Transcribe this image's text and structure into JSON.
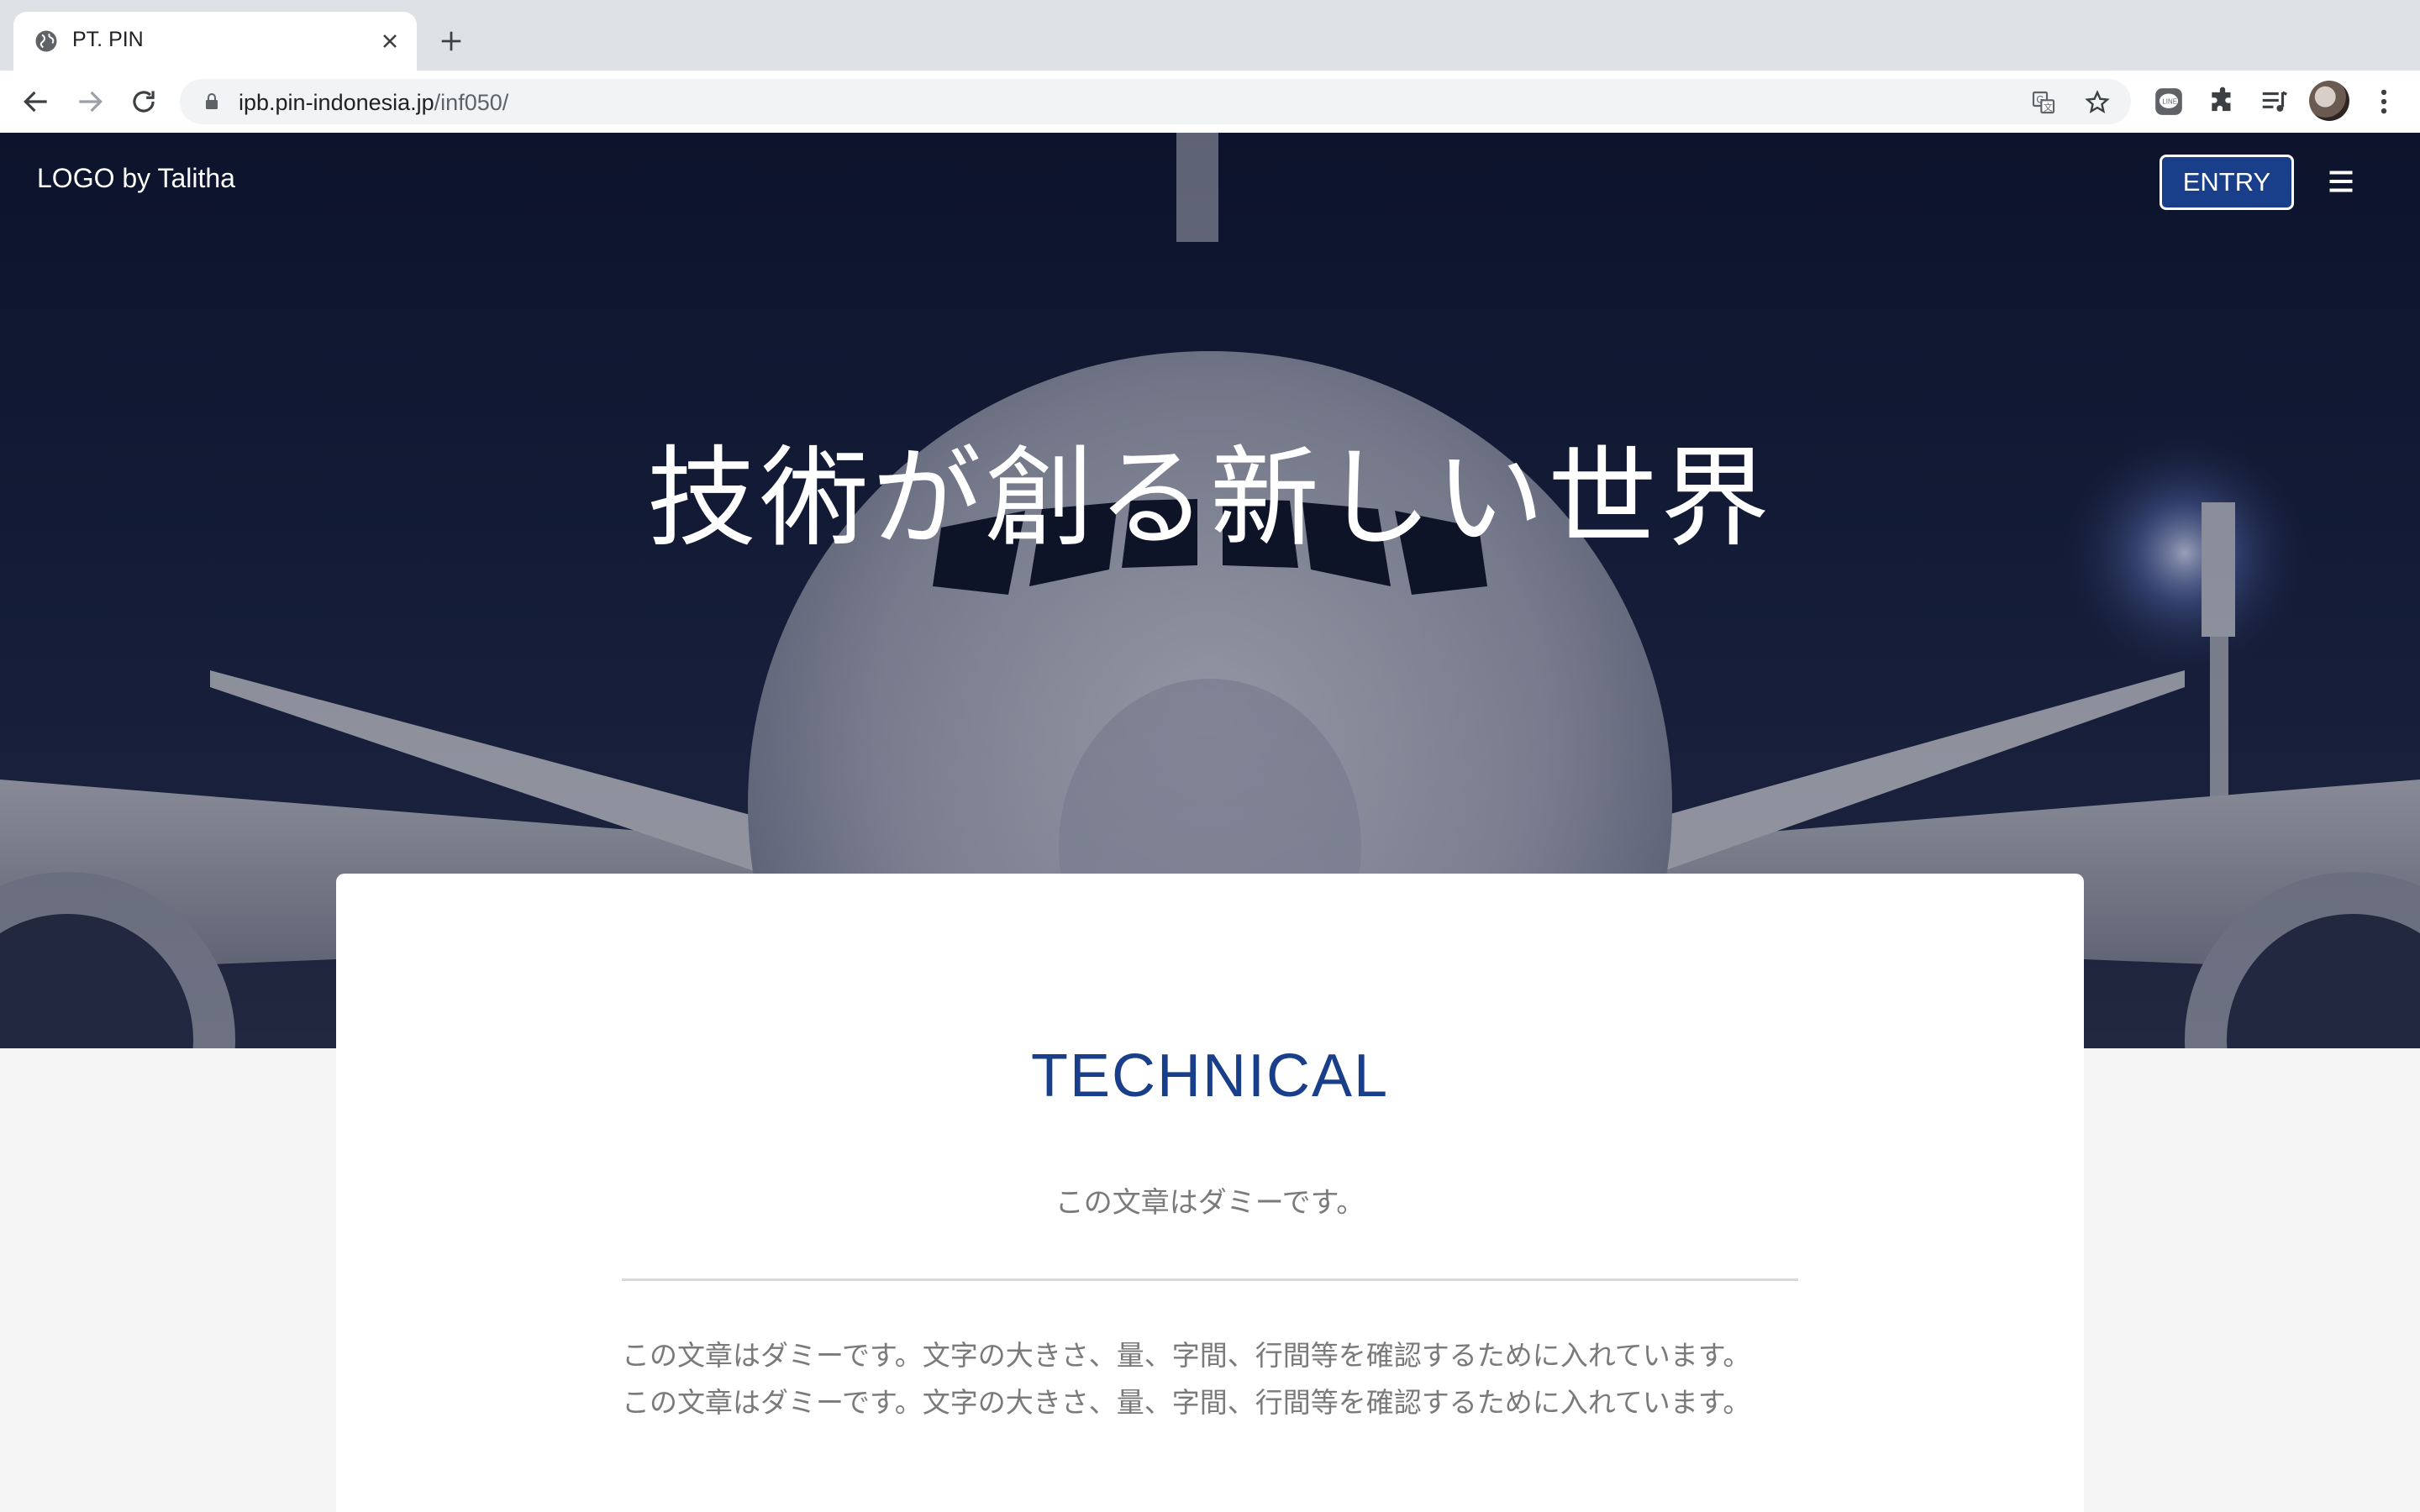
{
  "browser": {
    "tab_title": "PT. PIN",
    "url_host": "ipb.pin-indonesia.jp",
    "url_path": "/inf050/"
  },
  "site": {
    "logo": "LOGO by Talitha",
    "entry_label": "ENTRY",
    "accent_color": "#1a3f8a"
  },
  "hero": {
    "title": "技術が創る新しい世界"
  },
  "section": {
    "title": "TECHNICAL",
    "subtitle": "この文章はダミーです。",
    "body_lines": [
      "この文章はダミーです。文字の大きさ、量、字間、行間等を確認するために入れています。",
      "この文章はダミーです。文字の大きさ、量、字間、行間等を確認するために入れています。"
    ]
  }
}
